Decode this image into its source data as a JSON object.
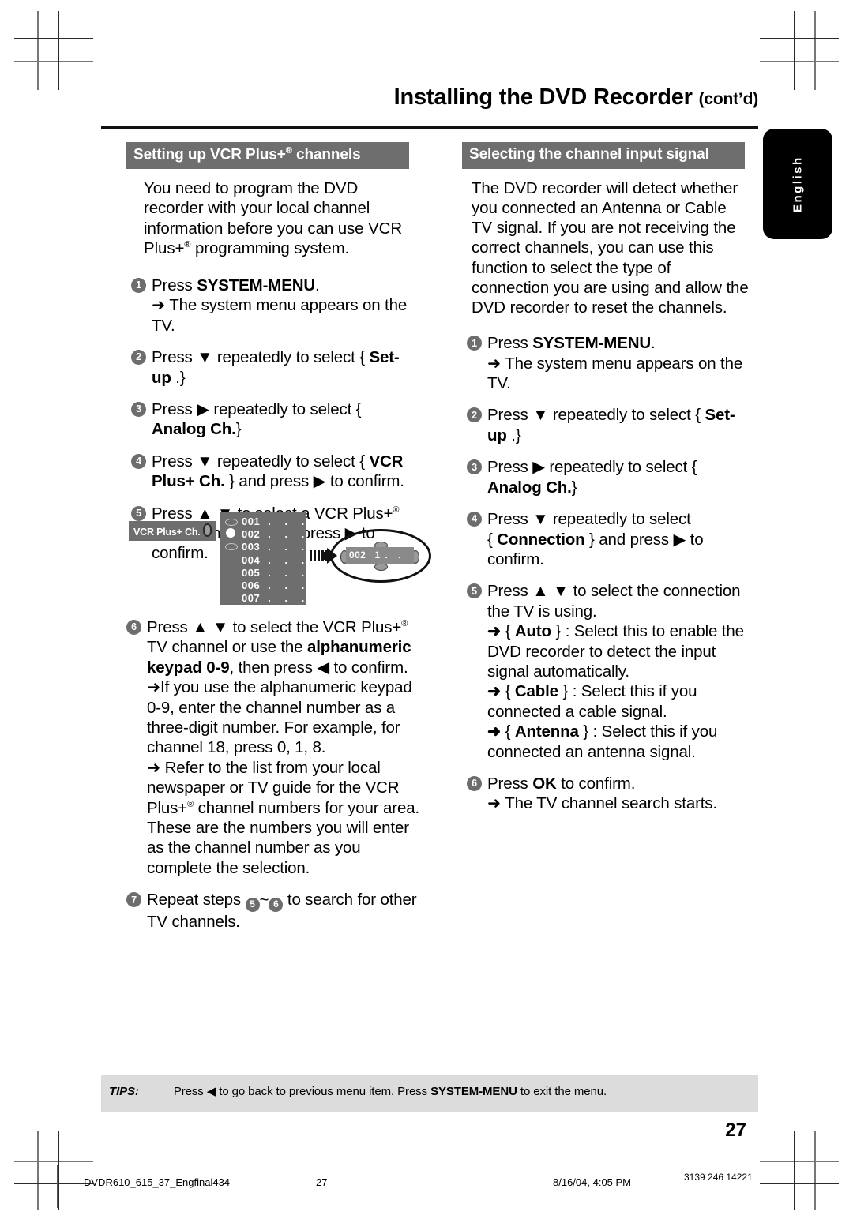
{
  "header": {
    "title": "Installing the DVD Recorder",
    "title_suffix": "(cont’d)"
  },
  "side_tab": {
    "label": "English"
  },
  "left_column": {
    "section_title": "Setting up VCR Plus+® channels",
    "section_title_main": "Setting up VCR Plus+",
    "section_title_tail": " channels",
    "intro": "You need to program the DVD recorder with your local channel information before you can use VCR Plus+® programming system.",
    "intro_part1": "You need to program the DVD recorder with your local channel information before you can use VCR Plus+",
    "intro_part2": " programming system.",
    "steps": [
      {
        "num": "1",
        "line": "Press SYSTEM-MENU.",
        "line_pre": "Press ",
        "line_bold": "SYSTEM-MENU",
        "line_post": ".",
        "sub": "➜ The system menu appears on the TV."
      },
      {
        "num": "2",
        "line_pre": "Press ▼ repeatedly to select { ",
        "line_bold": "Set-up",
        "line_post": " .}"
      },
      {
        "num": "3",
        "line_pre": "Press ▶ repeatedly to select { ",
        "line_bold": "Analog Ch.",
        "line_post": "}"
      },
      {
        "num": "4",
        "line_pre": "Press ▼ repeatedly to select { ",
        "line_bold": "VCR Plus+ Ch. ",
        "line_post": "} and press ▶ to confirm."
      },
      {
        "num": "5",
        "line_pre": "Press ▲ ▼ to select a VCR Plus+",
        "line_post": " channel number and press ▶ to confirm."
      },
      {
        "num": "6",
        "line_pre": "Press ▲ ▼ to select the VCR Plus+",
        "line_mid": " TV channel or use the ",
        "line_bold": "alphanumeric keypad 0-9",
        "line_post": ", then press ◀ to confirm.",
        "sub": "➜If you use the alphanumeric keypad 0-9, enter the channel number as a three-digit number. For example, for channel 18, press 0, 1, 8.",
        "sub2_pre": "➜ Refer to the list from your local newspaper or TV guide for the VCR Plus+",
        "sub2_post": " channel numbers for your area.  These are the numbers you will enter as the channel number as you complete the selection."
      },
      {
        "num": "7",
        "line_pre": "Repeat steps ",
        "step_a": "5",
        "tilde": "~",
        "step_b": "6",
        "line_post": " to search for other TV channels."
      }
    ]
  },
  "diagram": {
    "vcr_tag_label": "VCR Plus+ Ch.",
    "channel_rows": [
      {
        "number": "001",
        "dots": ". . ."
      },
      {
        "number": "002",
        "dots": ". . ."
      },
      {
        "number": "003",
        "dots": ". . ."
      },
      {
        "number": "004",
        "dots": ". . ."
      },
      {
        "number": "005",
        "dots": ". . ."
      },
      {
        "number": "006",
        "dots": ". . ."
      },
      {
        "number": "007",
        "dots": ". . ."
      }
    ],
    "selected_row": "002",
    "callout_number": "002",
    "callout_value": "1",
    "callout_dots": ". ."
  },
  "right_column": {
    "section_title": "Selecting the channel input signal",
    "intro": "The DVD recorder will detect whether you connected an Antenna or Cable TV signal.  If you are not receiving the correct channels, you can use this function to select the type of connection you are using and allow the DVD recorder to reset the channels.",
    "steps": [
      {
        "num": "1",
        "line_pre": "Press ",
        "line_bold": "SYSTEM-MENU",
        "line_post": ".",
        "sub": "➜ The system menu appears on the TV."
      },
      {
        "num": "2",
        "line_pre": "Press ▼ repeatedly to select { ",
        "line_bold": "Set-up",
        "line_post": " .}"
      },
      {
        "num": "3",
        "line_pre": "Press ▶ repeatedly to select { ",
        "line_bold": "Analog Ch.",
        "line_post": "}"
      },
      {
        "num": "4",
        "line_pre": "Press ▼ repeatedly to select",
        "line_bold": "Connection",
        "line_post": " } and press ▶ to confirm.",
        "brace_open": "{ "
      },
      {
        "num": "5",
        "line_pre": "Press ▲ ▼ to select the connection the TV is using.",
        "bullets": [
          {
            "arrow": "➜",
            "brace_open": "{ ",
            "bold": "Auto",
            "brace_close": " } ",
            "text": ": Select this to enable the DVD recorder to detect the input signal automatically."
          },
          {
            "arrow": "➜",
            "brace_open": "{ ",
            "bold": "Cable",
            "brace_close": " } ",
            "text": ": Select this if you connected a cable signal."
          },
          {
            "arrow": "➜",
            "brace_open": "{ ",
            "bold": "Antenna",
            "brace_close": " } ",
            "text": ": Select this if you connected an antenna signal."
          }
        ]
      },
      {
        "num": "6",
        "line_pre": "Press ",
        "line_bold": "OK",
        "line_post": " to confirm.",
        "sub": "➜ The TV channel search starts."
      }
    ]
  },
  "tips": {
    "label": "TIPS:",
    "text_pre": "Press ◀ to go back to previous menu item.  Press ",
    "text_bold": "SYSTEM-MENU",
    "text_post": " to exit the menu."
  },
  "page_number": "27",
  "print_footer": {
    "file": "DVDR610_615_37_Engfinal434",
    "page": "27",
    "date": "8/16/04, 4:05 PM",
    "code": "3139 246 14221"
  },
  "colors": {
    "section_header_bg": "#6e6e6e",
    "tips_bg": "#dcdcdc",
    "step_bullet": "#6d6d6d",
    "tab_bg": "#000000"
  }
}
